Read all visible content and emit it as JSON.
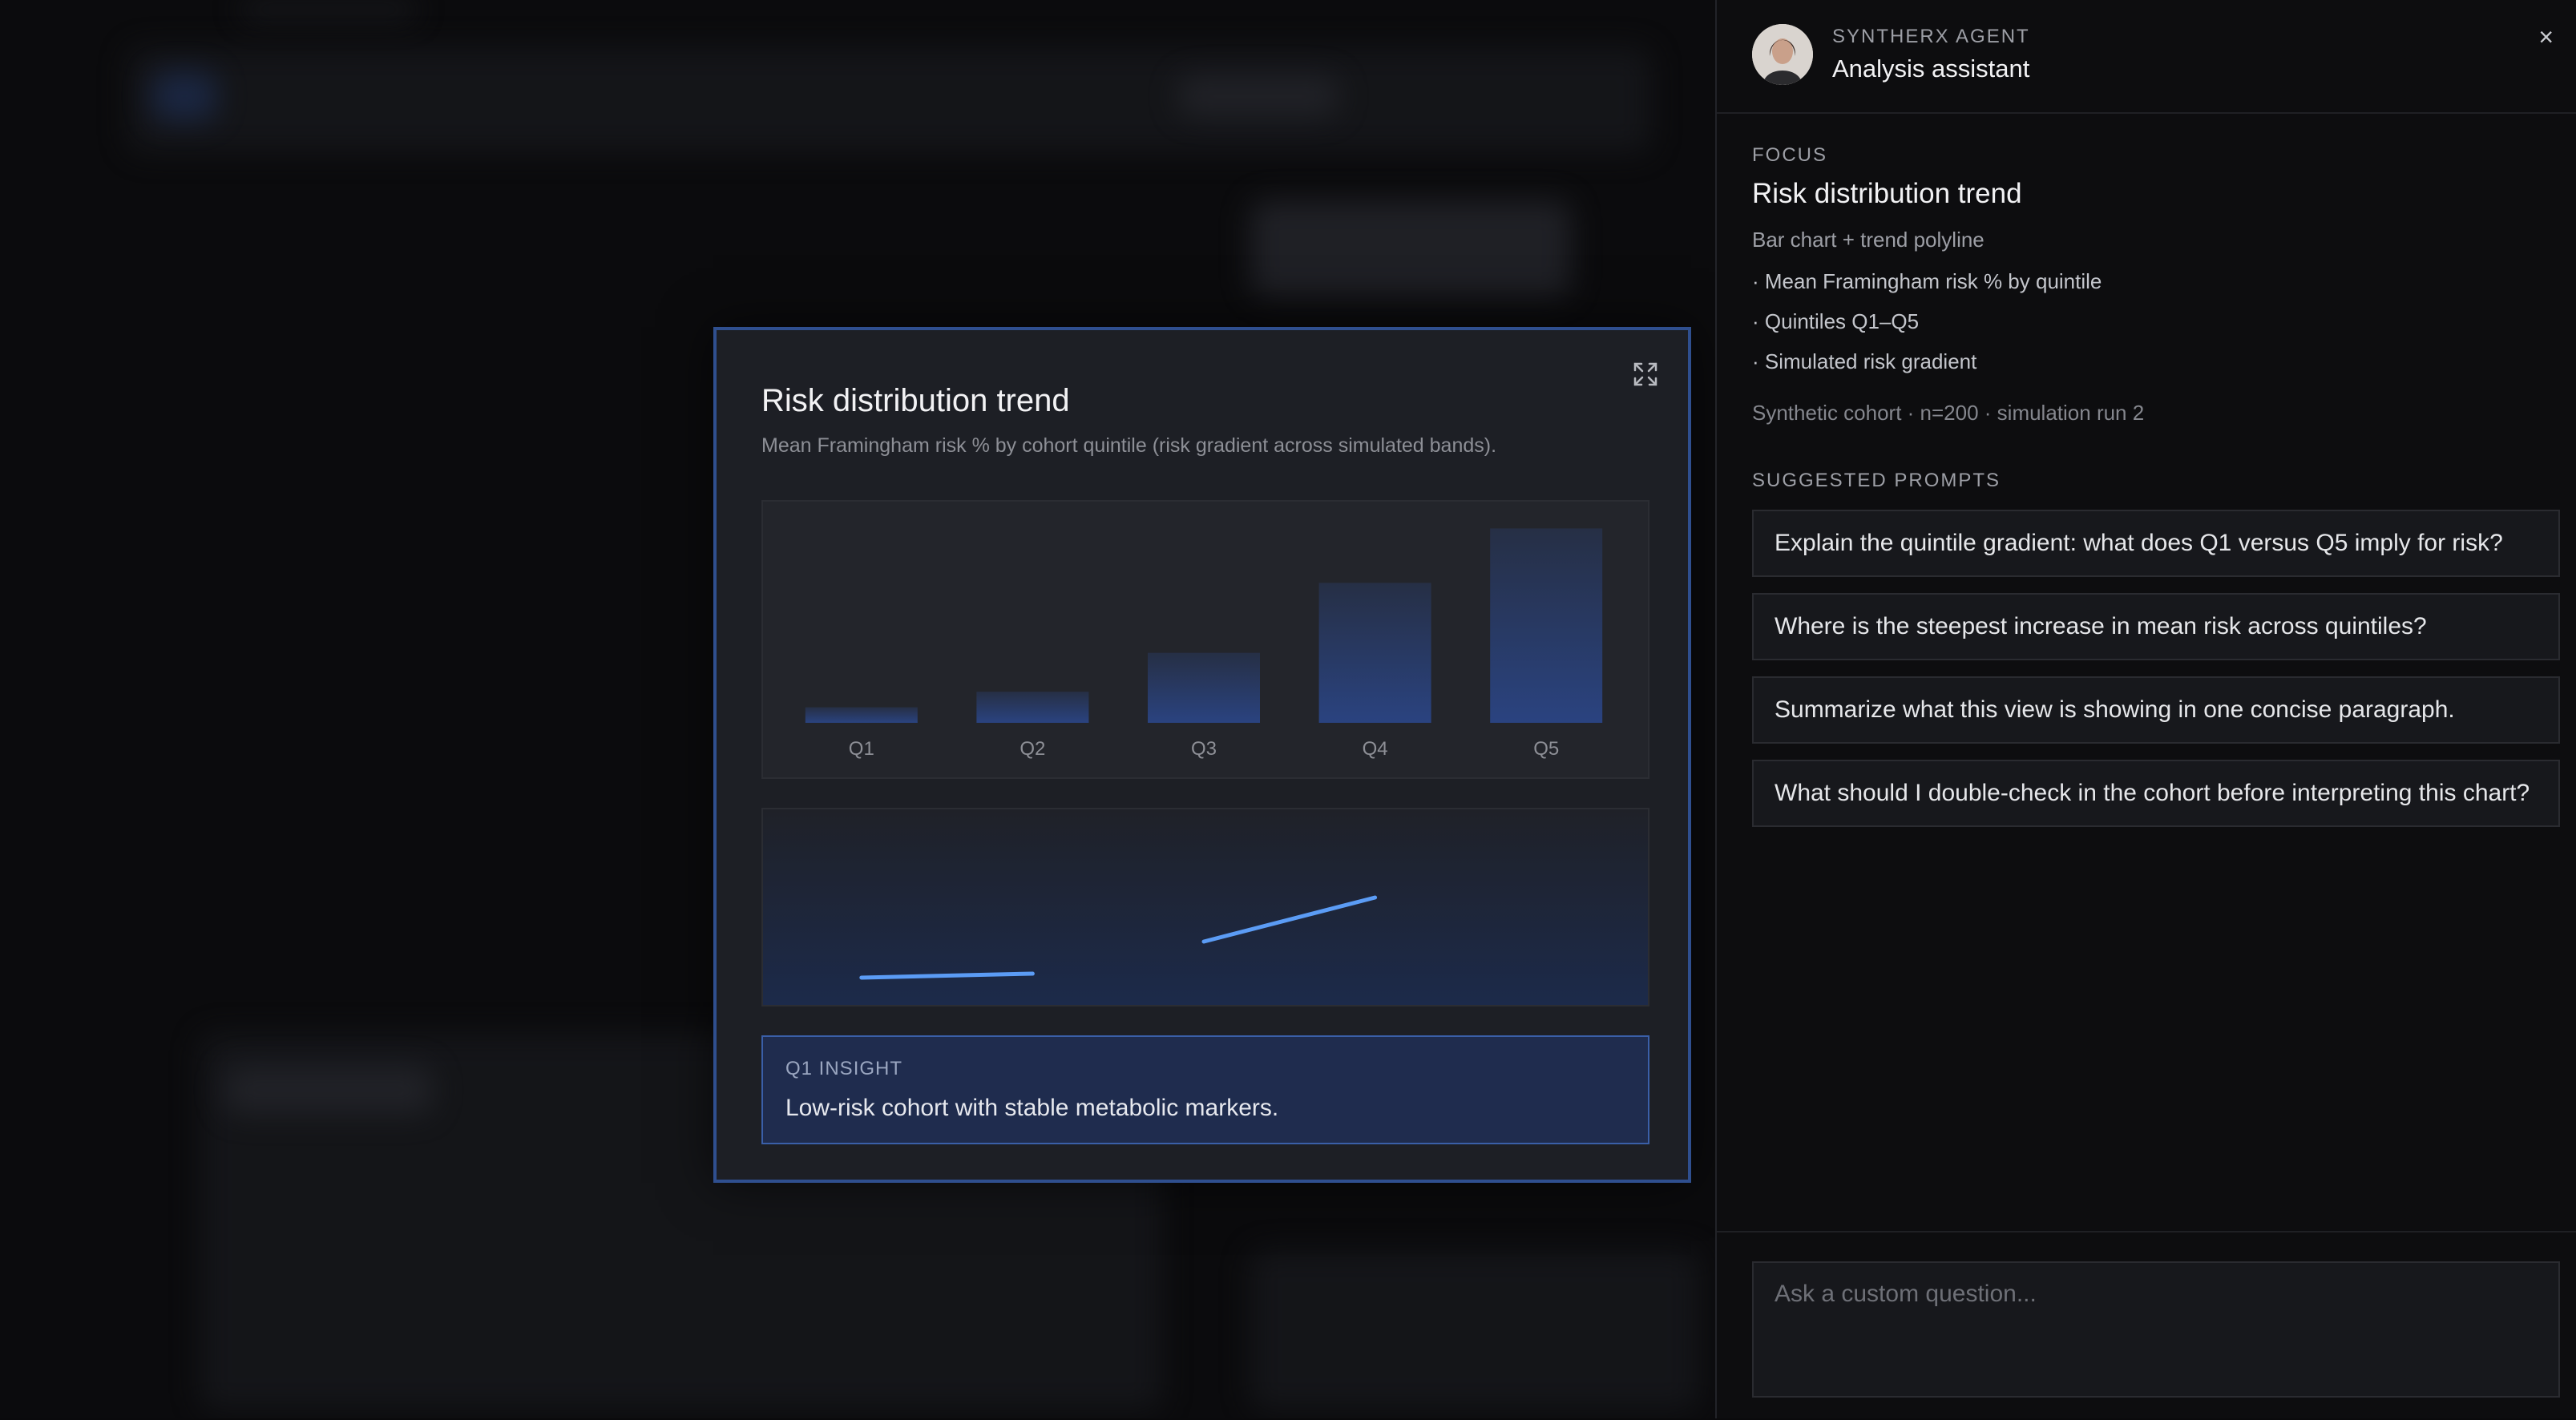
{
  "modal": {
    "title": "Risk distribution trend",
    "subtitle": "Mean Framingham risk % by cohort quintile (risk gradient across simulated bands).",
    "insight_label": "Q1 INSIGHT",
    "insight_text": "Low-risk cohort with stable metabolic markers."
  },
  "chart_data": [
    {
      "type": "bar",
      "categories": [
        "Q1",
        "Q2",
        "Q3",
        "Q4",
        "Q5"
      ],
      "values": [
        2,
        4,
        9,
        18,
        25
      ],
      "ylim": [
        0,
        27
      ],
      "grid": false,
      "color": "#2a4380"
    },
    {
      "type": "line",
      "x": [
        "Q1",
        "Q2",
        "Q3",
        "Q4",
        "Q5"
      ],
      "segments": [
        {
          "x": [
            "Q1",
            "Q2"
          ],
          "values": [
            4,
            6
          ]
        },
        {
          "x": [
            "Q3",
            "Q4"
          ],
          "values": [
            22,
            44
          ]
        }
      ],
      "ylim": [
        0,
        80
      ],
      "grid": false,
      "color": "#5b9cf5"
    }
  ],
  "panel": {
    "agent_kicker": "SYNTHERX AGENT",
    "agent_name": "Analysis assistant",
    "close_label": "×",
    "focus_label": "FOCUS",
    "focus_title": "Risk distribution trend",
    "focus_desc": "Bar chart + trend polyline",
    "bullets": [
      "· Mean Framingham risk % by quintile",
      "· Quintiles Q1–Q5",
      "· Simulated risk gradient"
    ],
    "meta": "Synthetic cohort · n=200 · simulation run 2",
    "prompts_label": "SUGGESTED PROMPTS",
    "prompts": [
      "Explain the quintile gradient: what does Q1 versus Q5 imply for risk?",
      "Where is the steepest increase in mean risk across quintiles?",
      "Summarize what this view is showing in one concise paragraph.",
      "What should I double-check in the cohort before interpreting this chart?"
    ],
    "ask_placeholder": "Ask a custom question..."
  },
  "colors": {
    "accent": "#3a5fa8",
    "line": "#5b9cf5",
    "bar": "#2a4380"
  }
}
